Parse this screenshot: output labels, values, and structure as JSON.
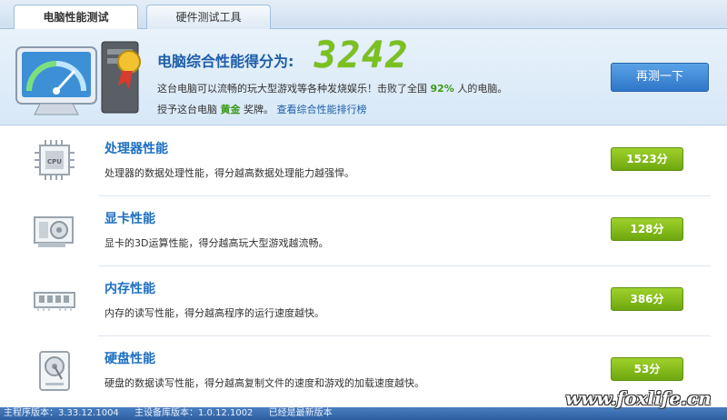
{
  "tabs": [
    {
      "label": "电脑性能测试",
      "active": true
    },
    {
      "label": "硬件测试工具",
      "active": false
    }
  ],
  "score": {
    "label": "电脑综合性能得分为:",
    "value": "3242",
    "desc_prefix": "这台电脑可以流畅的玩大型游戏等各种发烧娱乐！击败了全国",
    "percent": "92%",
    "desc_suffix": "人的电脑。",
    "award_prefix": "授予这台电脑",
    "medal": "黄金",
    "award_suffix": "奖牌。",
    "rank_link": "查看综合性能排行榜",
    "retest_button": "再测一下"
  },
  "items": [
    {
      "title": "处理器性能",
      "desc": "处理器的数据处理性能，得分越高数据处理能力越强悍。",
      "score": "1523分",
      "icon": "cpu-icon"
    },
    {
      "title": "显卡性能",
      "desc": "显卡的3D运算性能，得分越高玩大型游戏越流畅。",
      "score": "128分",
      "icon": "graphics-card-icon"
    },
    {
      "title": "内存性能",
      "desc": "内存的读写性能，得分越高程序的运行速度越快。",
      "score": "386分",
      "icon": "memory-icon"
    },
    {
      "title": "硬盘性能",
      "desc": "硬盘的数据读写性能，得分越高复制文件的速度和游戏的加载速度越快。",
      "score": "53分",
      "icon": "hard-disk-icon"
    }
  ],
  "status": {
    "main_version": "主程序版本：3.33.12.1004",
    "db_version": "主设备库版本：1.0.12.1002",
    "latest": "已经是最新版本"
  },
  "watermark": "www.foxlife.cn",
  "colors": {
    "accent_blue": "#1d6fc1",
    "score_green": "#7bc11e",
    "badge_green": "#6ea80f",
    "button_blue": "#2f77c9"
  }
}
